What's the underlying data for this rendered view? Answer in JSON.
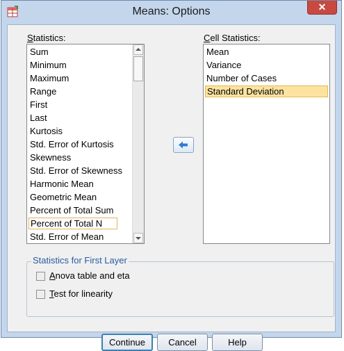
{
  "window": {
    "title": "Means: Options",
    "close_label": "✕"
  },
  "statistics": {
    "label": "Statistics:",
    "items": [
      "Sum",
      "Minimum",
      "Maximum",
      "Range",
      "First",
      "Last",
      "Kurtosis",
      "Std. Error of Kurtosis",
      "Skewness",
      "Std. Error of Skewness",
      "Harmonic Mean",
      "Geometric Mean",
      "Percent of Total Sum",
      "Percent of Total N",
      "Std. Error of Mean"
    ],
    "focused_item": "Percent of Total N"
  },
  "cell_statistics": {
    "label": "Cell Statistics:",
    "items": [
      "Mean",
      "Variance",
      "Number of Cases",
      "Standard Deviation"
    ],
    "selected_item": "Standard Deviation"
  },
  "first_layer": {
    "legend": "Statistics for First Layer",
    "anova_label": "Anova table and eta",
    "linearity_label": "Test for linearity",
    "anova_checked": false,
    "linearity_checked": false
  },
  "buttons": {
    "continue": "Continue",
    "cancel": "Cancel",
    "help": "Help"
  },
  "colors": {
    "accent": "#3c7fb1",
    "selection": "#fde3a0",
    "close": "#c7493f",
    "legend_text": "#2a5aa0"
  },
  "icons": {
    "app": "spss-table-icon",
    "move": "arrow-left-icon",
    "close": "close-icon"
  }
}
